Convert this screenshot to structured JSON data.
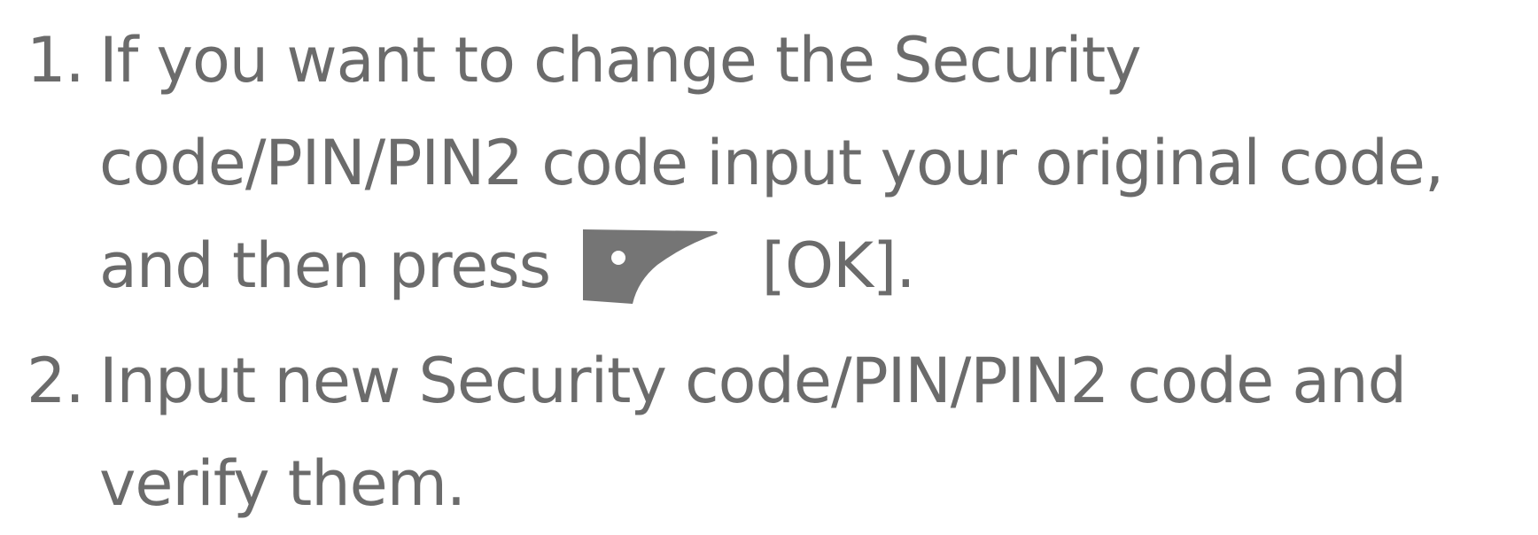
{
  "steps": [
    {
      "number": "1.",
      "lines": [
        "If you want to change the Security",
        "code/PIN/PIN2 code input your original code,"
      ],
      "last_line_before_icon": "and then press",
      "icon": "left-soft-key-icon",
      "last_line_after_icon": "[OK]."
    },
    {
      "number": "2.",
      "lines": [
        "Input new Security code/PIN/PIN2 code and",
        "verify them."
      ]
    }
  ],
  "colors": {
    "text": "#6b6b6b",
    "icon": "#757575"
  }
}
